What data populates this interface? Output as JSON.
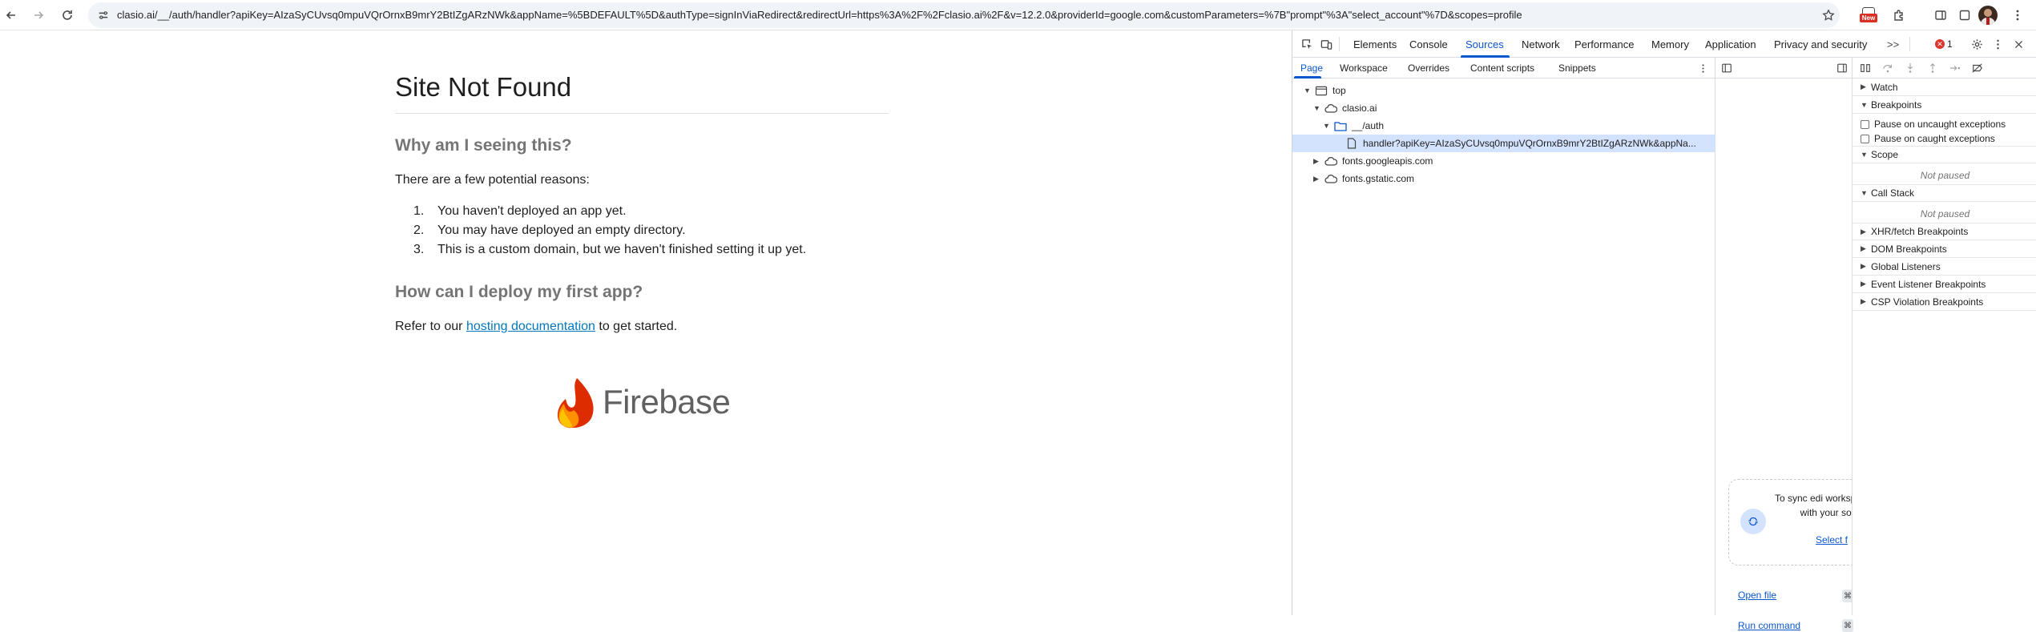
{
  "browser": {
    "url": "clasio.ai/__/auth/handler?apiKey=AIzaSyCUvsq0mpuVQrOrnxB9mrY2BtIZgARzNWk&appName=%5BDEFAULT%5D&authType=signInViaRedirect&redirectUrl=https%3A%2F%2Fclasio.ai%2F&v=12.2.0&providerId=google.com&customParameters=%7B\"prompt\"%3A\"select_account\"%7D&scopes=profile",
    "ext_badge": "New"
  },
  "page": {
    "title": "Site Not Found",
    "why_heading": "Why am I seeing this?",
    "reasons_intro": "There are a few potential reasons:",
    "reasons": [
      {
        "num": "1.",
        "text": "You haven't deployed an app yet."
      },
      {
        "num": "2.",
        "text": "You may have deployed an empty directory."
      },
      {
        "num": "3.",
        "text": "This is a custom domain, but we haven't finished setting it up yet."
      }
    ],
    "deploy_heading": "How can I deploy my first app?",
    "refer_prefix": "Refer to our",
    "refer_link": "hosting documentation",
    "refer_suffix": "to get started.",
    "logo_text": "Firebase"
  },
  "devtools": {
    "tabs": [
      "Elements",
      "Console",
      "Sources",
      "Network",
      "Performance",
      "Memory",
      "Application",
      "Privacy and security"
    ],
    "active_tab": "Sources",
    "more_tabs": ">>",
    "error_count": "1",
    "navigator_tabs": [
      "Page",
      "Workspace",
      "Overrides",
      "Content scripts",
      "Snippets"
    ],
    "tree": {
      "top": "top",
      "domain": "clasio.ai",
      "folder": "__/auth",
      "file": "handler?apiKey=AIzaSyCUvsq0mpuVQrOrnxB9mrY2BtIZgARzNWk&appNa...",
      "other1": "fonts.googleapis.com",
      "other2": "fonts.gstatic.com"
    },
    "sync_text": "To sync edi workspace, dr with your sour",
    "sync_link": "Select f",
    "shortcuts": [
      {
        "label": "Open file",
        "key": "⌘"
      },
      {
        "label": "Run command",
        "key": "⌘"
      }
    ],
    "debugger": {
      "watch": "Watch",
      "breakpoints": "Breakpoints",
      "pause_uncaught": "Pause on uncaught exceptions",
      "pause_caught": "Pause on caught exceptions",
      "scope": "Scope",
      "scope_status": "Not paused",
      "call_stack": "Call Stack",
      "call_stack_status": "Not paused",
      "xhr": "XHR/fetch Breakpoints",
      "dom": "DOM Breakpoints",
      "global": "Global Listeners",
      "event": "Event Listener Breakpoints",
      "csp": "CSP Violation Breakpoints"
    }
  },
  "colors": {
    "accent": "#0b57d0",
    "link": "#0277bd",
    "error": "#dc362e",
    "firebase_orange": "#ff9100",
    "firebase_red": "#dd2c00",
    "firebase_yellow": "#ffc400"
  }
}
